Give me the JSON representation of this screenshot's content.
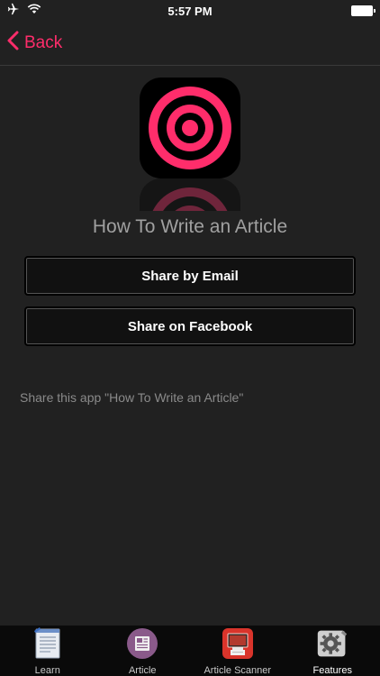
{
  "status_bar": {
    "time": "5:57 PM",
    "icons": [
      "airplane-icon",
      "wifi-icon",
      "battery-icon"
    ]
  },
  "nav": {
    "back_label": "Back"
  },
  "app": {
    "title": "How To Write an Article",
    "icon": "target-icon"
  },
  "actions": {
    "share_email": "Share by Email",
    "share_facebook": "Share on Facebook"
  },
  "share_text": "Share this app \"How To Write an Article\"",
  "tabs": [
    {
      "label": "Learn",
      "icon": "learn-doc-icon",
      "active": false
    },
    {
      "label": "Article",
      "icon": "article-icon",
      "active": false
    },
    {
      "label": "Article Scanner",
      "icon": "scanner-icon",
      "active": false
    },
    {
      "label": "Features",
      "icon": "features-gear-icon",
      "active": true
    }
  ],
  "colors": {
    "accent": "#ff2d6b",
    "background": "#212121"
  }
}
